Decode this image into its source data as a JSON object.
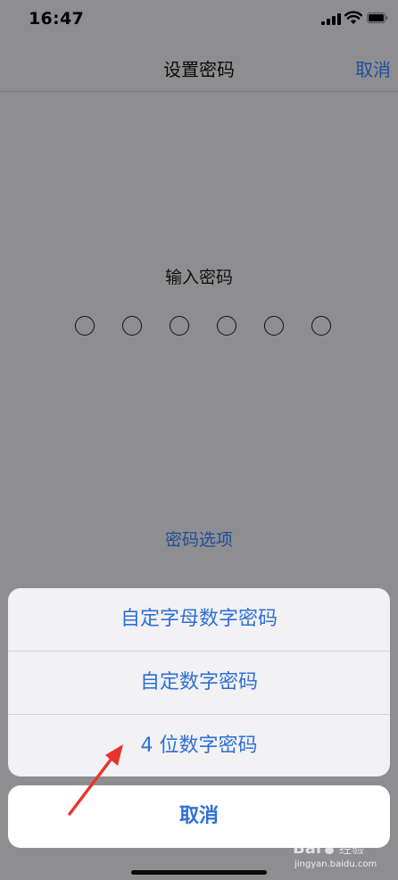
{
  "status_bar": {
    "time": "16:47",
    "signal_icon": "cellular-signal-icon",
    "wifi_icon": "wifi-icon",
    "battery_icon": "battery-icon"
  },
  "nav": {
    "title": "设置密码",
    "cancel_label": "取消"
  },
  "passcode": {
    "prompt": "输入密码",
    "digit_count": 6,
    "options_label": "密码选项"
  },
  "action_sheet": {
    "items": [
      {
        "label": "自定字母数字密码"
      },
      {
        "label": "自定数字密码"
      },
      {
        "label": "4 位数字密码"
      }
    ],
    "cancel_label": "取消"
  },
  "annotation": {
    "icon": "red-arrow-icon",
    "color": "#e8342c"
  },
  "watermark": {
    "logo": "Baidu经验",
    "url": "jingyan.baidu.com"
  },
  "colors": {
    "accent": "#2f6fd6",
    "nav_accent": "#1e4f9a",
    "dim_background": "#8e8e91",
    "sheet_background": "#f2f2f4"
  }
}
